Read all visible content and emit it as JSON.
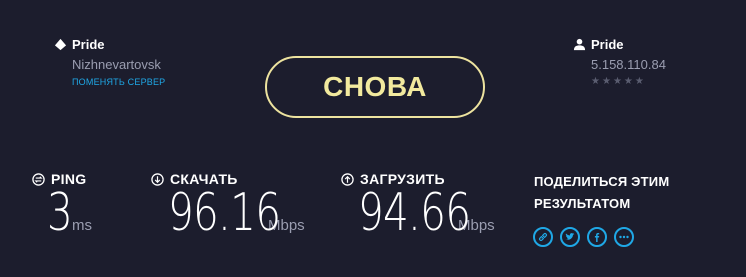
{
  "server": {
    "name": "Pride",
    "location": "Nizhnevartovsk",
    "change_link": "ПОМЕНЯТЬ СЕРВЕР"
  },
  "isp": {
    "name": "Pride",
    "ip": "5.158.110.84",
    "rating_stars": 5,
    "rating_filled": 0
  },
  "go_button": {
    "label": "СНОВА"
  },
  "metrics": {
    "ping": {
      "label": "PING",
      "value": "3",
      "unit": "ms"
    },
    "download": {
      "label": "СКАЧАТЬ",
      "value": "96.16",
      "unit": "Mbps"
    },
    "upload": {
      "label": "ЗАГРУЗИТЬ",
      "value": "94.66",
      "unit": "Mbps"
    }
  },
  "share": {
    "title_line1": "ПОДЕЛИТЬСЯ ЭТИМ",
    "title_line2": "РЕЗУЛЬТАТОМ",
    "icons": [
      "link-icon",
      "twitter-icon",
      "facebook-icon",
      "more-icon"
    ]
  },
  "colors": {
    "background": "#1c1d2d",
    "accent_yellow": "#ede39f",
    "accent_blue": "#1fa8e6",
    "muted_text": "#9a9db0"
  }
}
